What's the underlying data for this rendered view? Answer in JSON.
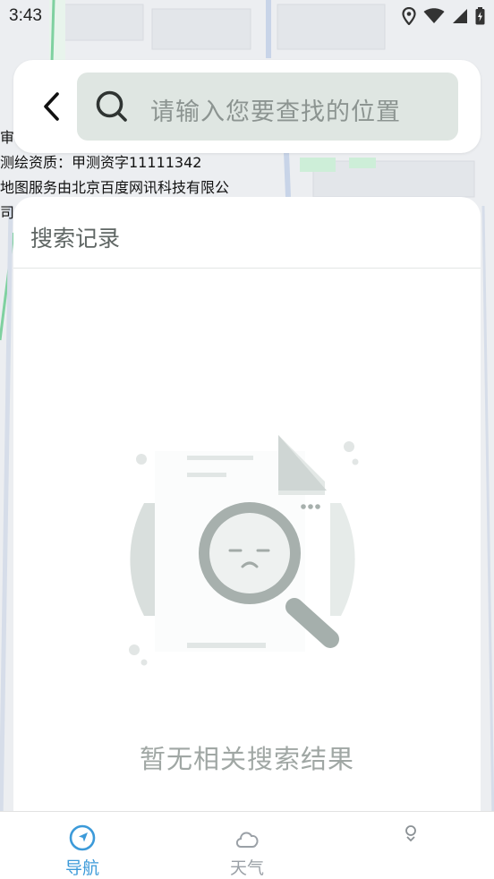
{
  "status_bar": {
    "time": "3:43"
  },
  "search": {
    "placeholder": "请输入您要查找的位置"
  },
  "map_info": {
    "lines": [
      "审",
      "测绘资质：甲测资字11111342",
      "地图服务由北京百度网讯科技有限公",
      "司"
    ]
  },
  "history": {
    "title": "搜索记录",
    "empty_text": "暂无相关搜索结果"
  },
  "tabbar": {
    "tabs": [
      {
        "label": "导航",
        "icon": "navigation-icon",
        "active": true
      },
      {
        "label": "天气",
        "icon": "cloud-icon",
        "active": false
      },
      {
        "label": "",
        "icon": "app-icon",
        "active": false
      }
    ]
  },
  "colors": {
    "accent": "#3c9ad9",
    "search_bg": "#dfe6e2",
    "placeholder": "#8c9491",
    "tab_inactive": "#9aa0a6"
  }
}
